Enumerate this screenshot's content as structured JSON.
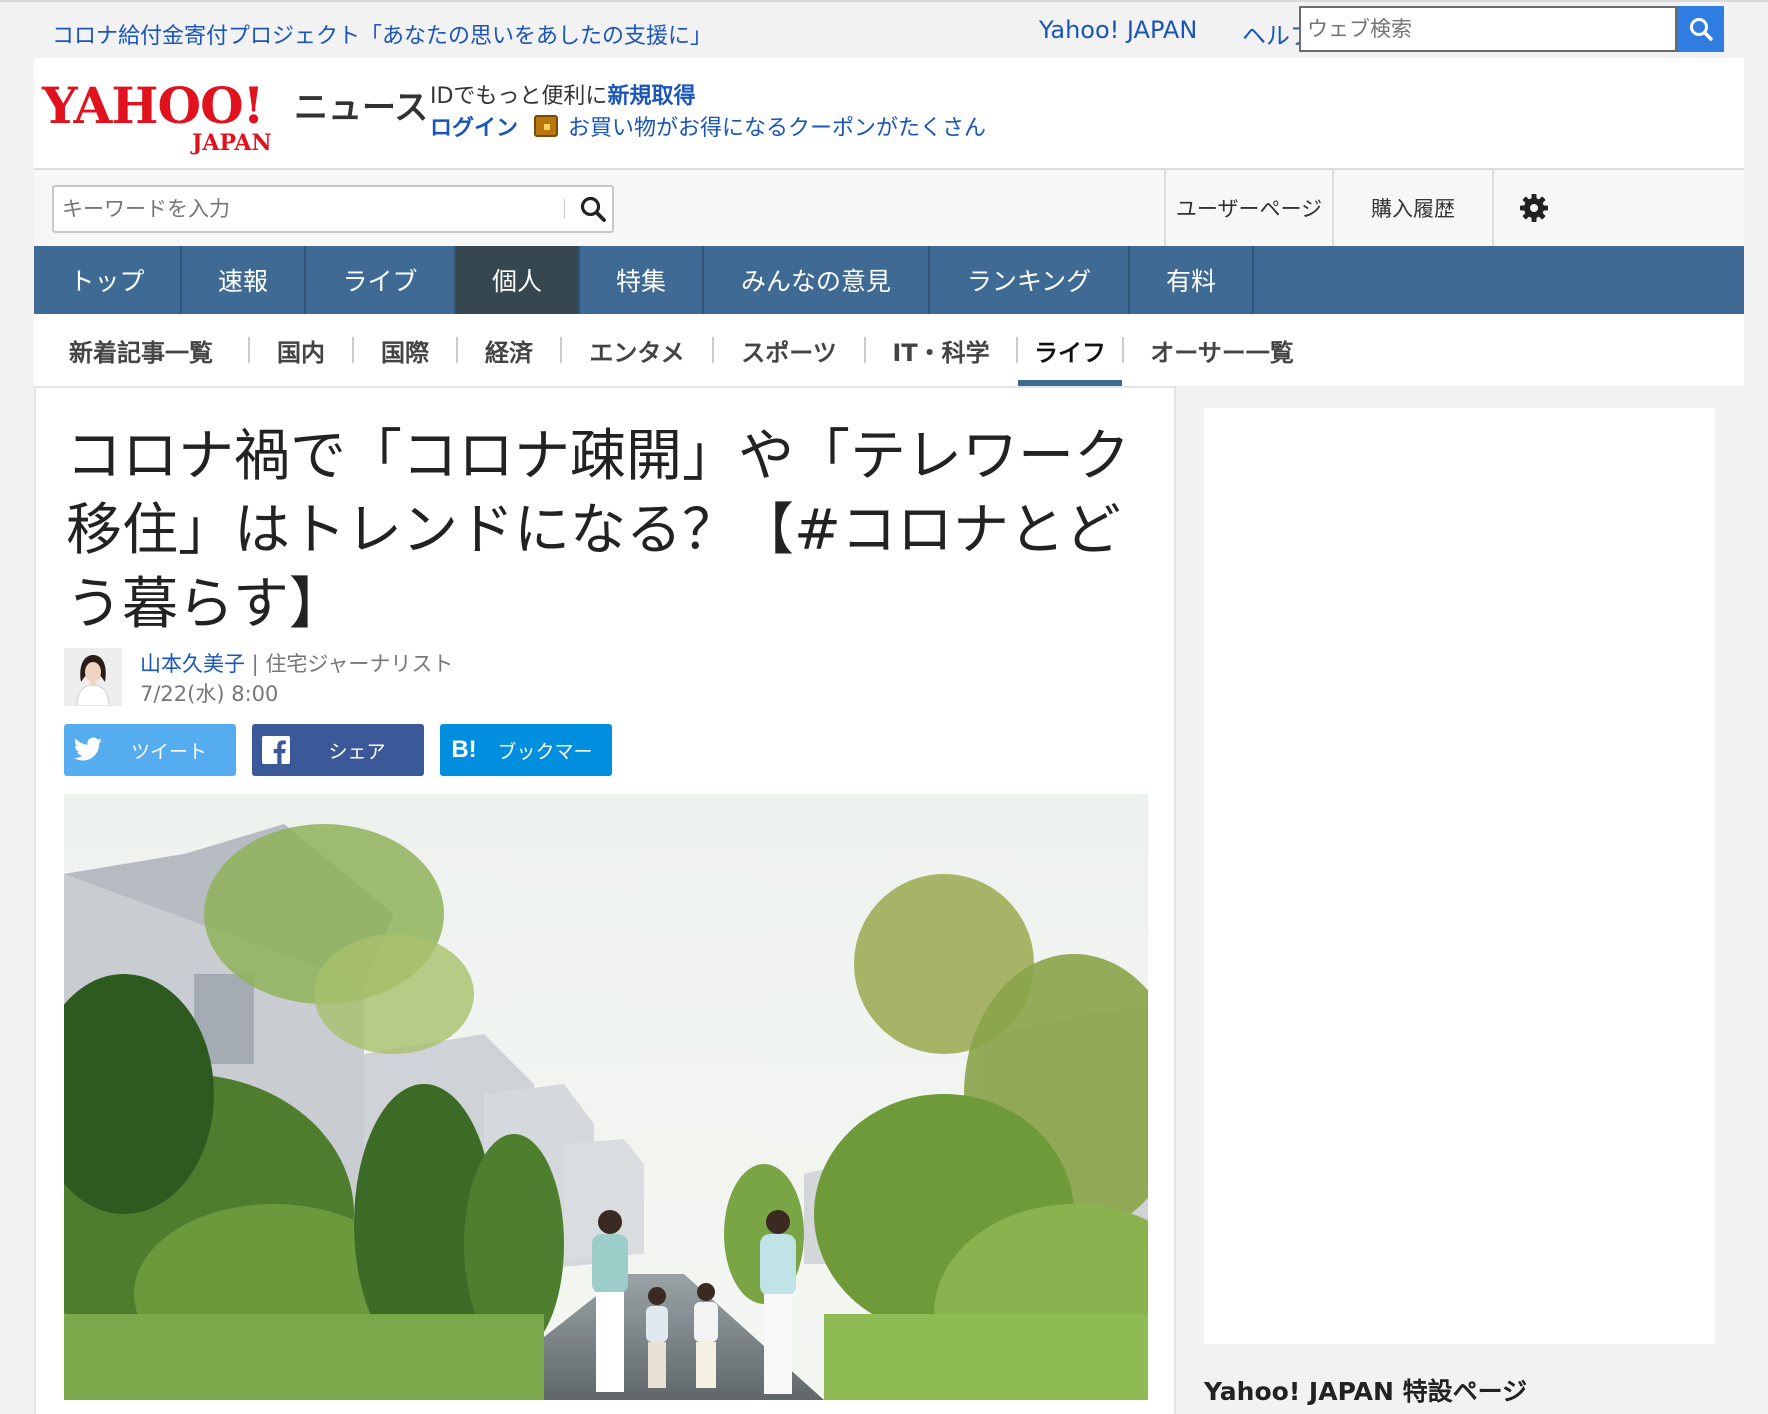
{
  "topbar": {
    "promo": "コロナ給付金寄付プロジェクト「あなたの思いをあしたの支援に」",
    "yahoo_japan": "Yahoo! JAPAN",
    "help": "ヘルプ",
    "web_search_placeholder": "ウェブ検索"
  },
  "header": {
    "logo_yahoo": "YAHOO!",
    "logo_japan": "JAPAN",
    "logo_news": "ニュース",
    "id_text": "IDでもっと便利に",
    "id_signup": "新規取得",
    "login": "ログイン",
    "coupon": "お買い物がお得になるクーポンがたくさん"
  },
  "search": {
    "placeholder": "キーワードを入力",
    "user_page": "ユーザーページ",
    "purchase_history": "購入履歴"
  },
  "gnav": {
    "items": [
      "トップ",
      "速報",
      "ライブ",
      "個人",
      "特集",
      "みんなの意見",
      "ランキング",
      "有料"
    ],
    "active": "個人"
  },
  "subnav": {
    "items": [
      "新着記事一覧",
      "国内",
      "国際",
      "経済",
      "エンタメ",
      "スポーツ",
      "IT・科学",
      "ライフ",
      "オーサー一覧"
    ],
    "active": "ライフ"
  },
  "article": {
    "title": "コロナ禍で「コロナ疎開」や「テレワーク移住」はトレンドになる？【#コロナとどう暮らす】",
    "author_name": "山本久美子",
    "author_role": " | 住宅ジャーナリスト",
    "date": "7/22(水) 8:00"
  },
  "share": {
    "tweet": "ツイート",
    "facebook": "シェア",
    "hatena": "ブックマー",
    "hatena_icon_text": "B!"
  },
  "sidebar": {
    "special_title": "Yahoo! JAPAN 特設ページ"
  },
  "colors": {
    "link": "#1a55b8",
    "nav": "#3e6a93",
    "nav_active": "#36474f",
    "twitter": "#55acee",
    "facebook": "#3b5998",
    "hatena": "#008fde",
    "yahoo_red": "#e1111d"
  }
}
